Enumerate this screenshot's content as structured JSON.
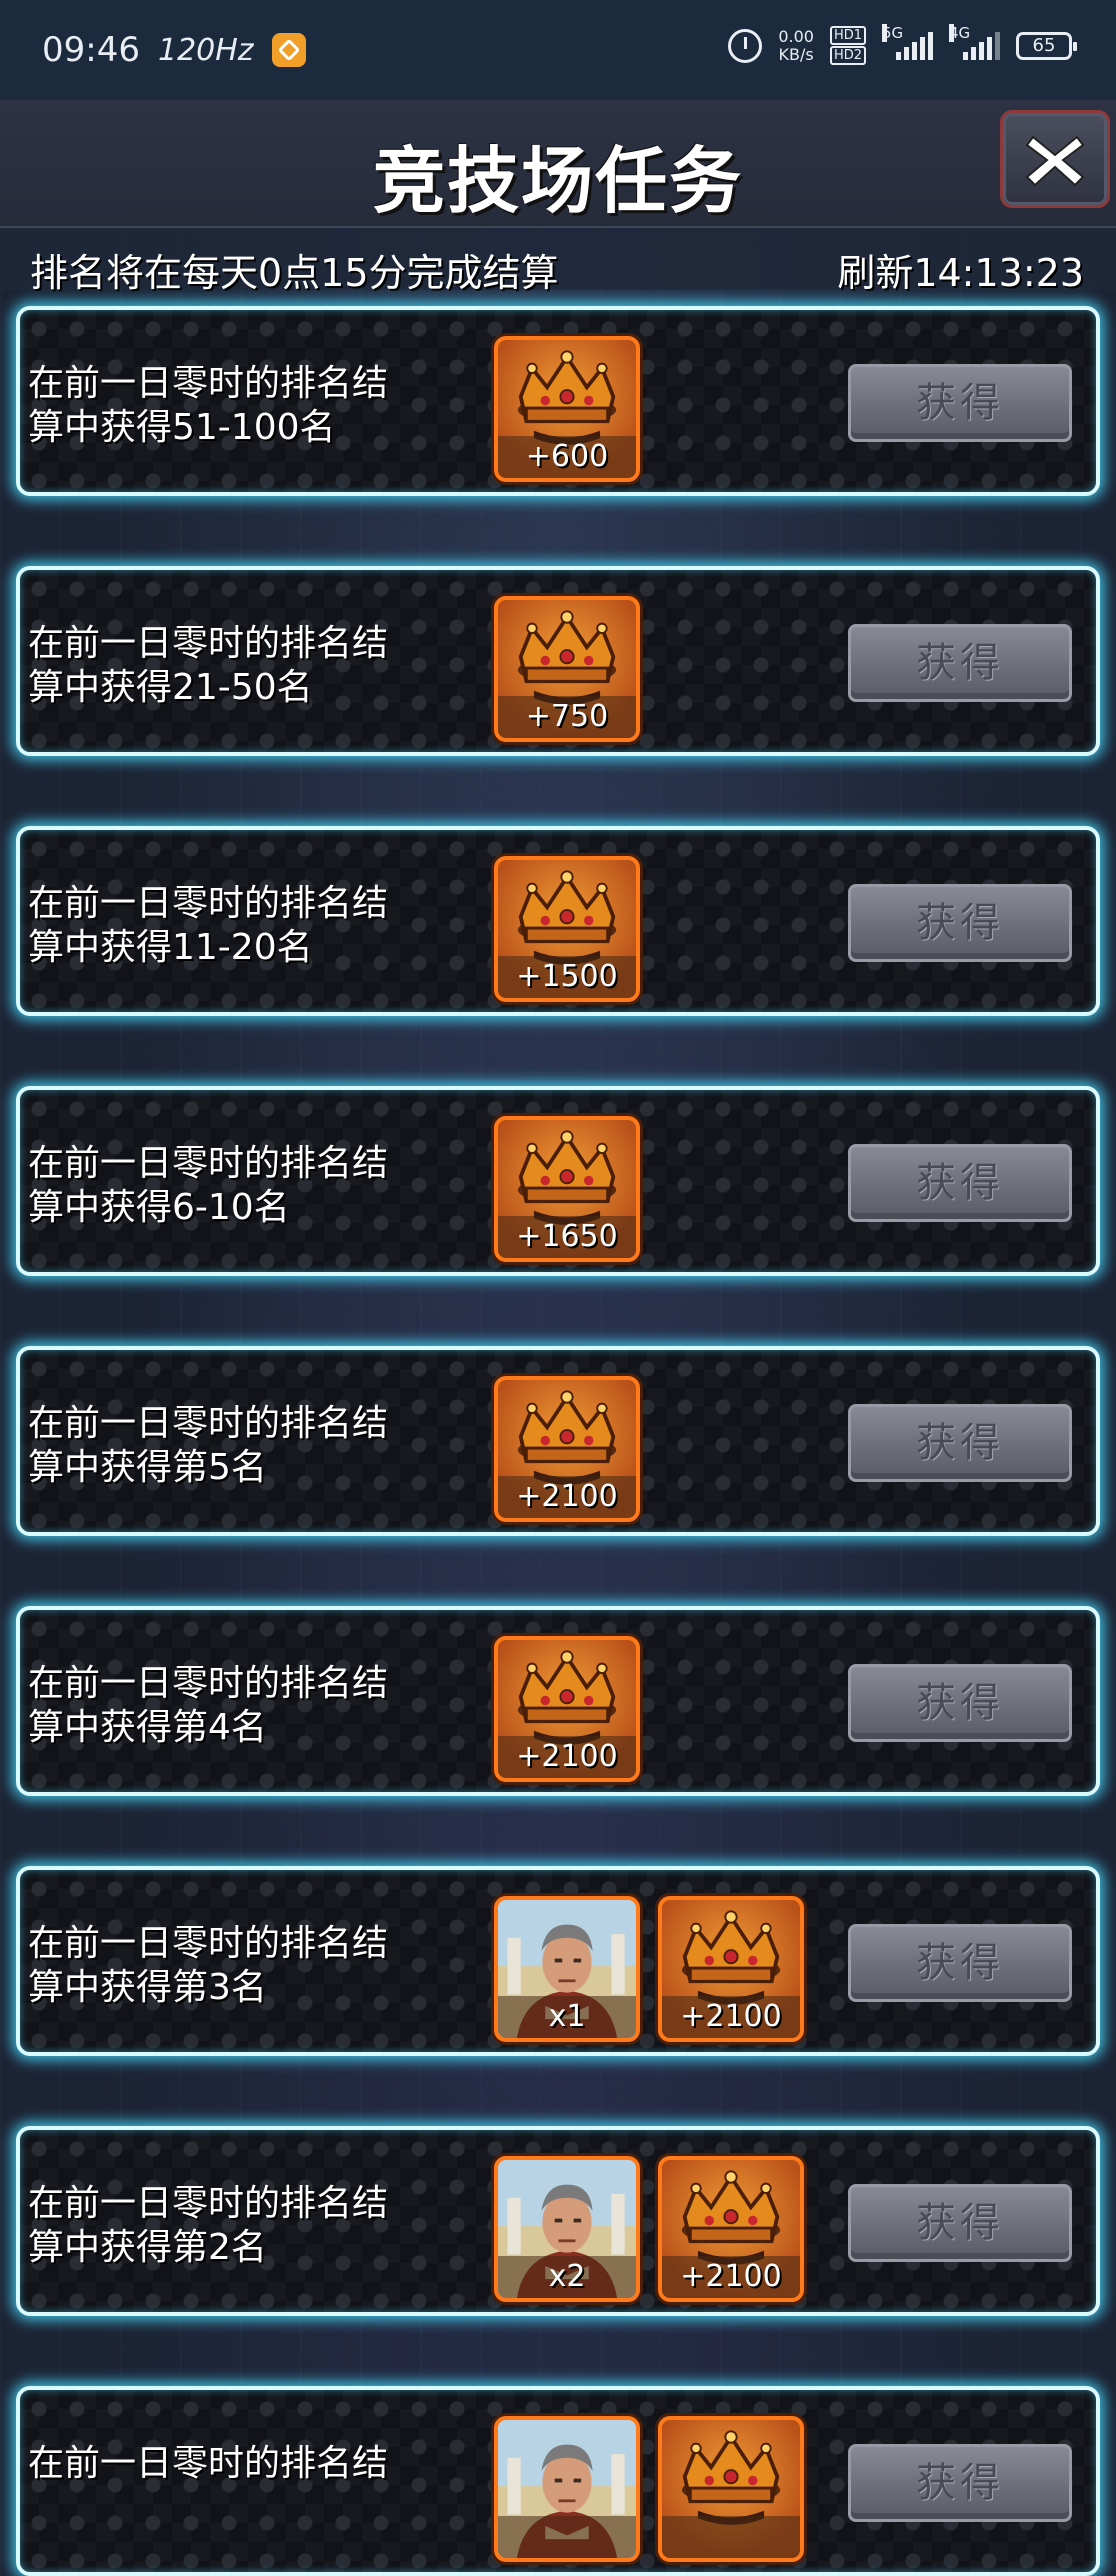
{
  "status_bar": {
    "time": "09:46",
    "refresh_rate": "120Hz",
    "net_speed_value": "0.00",
    "net_speed_unit": "KB/s",
    "hd1": "HD1",
    "hd2": "HD2",
    "sim1": "5G",
    "sim2": "4G",
    "battery": "65"
  },
  "header": {
    "title": "竞技场任务",
    "settle_notice": "排名将在每天0点15分完成结算",
    "refresh_label": "刷新14:13:23"
  },
  "tasks": [
    {
      "desc_line1": "在前一日零时的排名结",
      "desc_line2": "算中获得51-100名",
      "rewards": [
        {
          "icon": "crown-icon",
          "amount": "+600"
        }
      ],
      "button": "获得"
    },
    {
      "desc_line1": "在前一日零时的排名结",
      "desc_line2": "算中获得21-50名",
      "rewards": [
        {
          "icon": "crown-icon",
          "amount": "+750"
        }
      ],
      "button": "获得"
    },
    {
      "desc_line1": "在前一日零时的排名结",
      "desc_line2": "算中获得11-20名",
      "rewards": [
        {
          "icon": "crown-icon",
          "amount": "+1500"
        }
      ],
      "button": "获得"
    },
    {
      "desc_line1": "在前一日零时的排名结",
      "desc_line2": "算中获得6-10名",
      "rewards": [
        {
          "icon": "crown-icon",
          "amount": "+1650"
        }
      ],
      "button": "获得"
    },
    {
      "desc_line1": "在前一日零时的排名结",
      "desc_line2": "算中获得第5名",
      "rewards": [
        {
          "icon": "crown-icon",
          "amount": "+2100"
        }
      ],
      "button": "获得"
    },
    {
      "desc_line1": "在前一日零时的排名结",
      "desc_line2": "算中获得第4名",
      "rewards": [
        {
          "icon": "crown-icon",
          "amount": "+2100"
        }
      ],
      "button": "获得"
    },
    {
      "desc_line1": "在前一日零时的排名结",
      "desc_line2": "算中获得第3名",
      "rewards": [
        {
          "icon": "hero-portrait-icon",
          "amount": "x1"
        },
        {
          "icon": "crown-icon",
          "amount": "+2100"
        }
      ],
      "button": "获得"
    },
    {
      "desc_line1": "在前一日零时的排名结",
      "desc_line2": "算中获得第2名",
      "rewards": [
        {
          "icon": "hero-portrait-icon",
          "amount": "x2"
        },
        {
          "icon": "crown-icon",
          "amount": "+2100"
        }
      ],
      "button": "获得"
    },
    {
      "desc_line1": "在前一日零时的排名结",
      "desc_line2": "",
      "rewards": [
        {
          "icon": "hero-portrait-icon",
          "amount": ""
        },
        {
          "icon": "crown-icon",
          "amount": ""
        }
      ],
      "button": "获得"
    }
  ],
  "colors": {
    "row_glow": "#46dcff",
    "reward_border": "#ff7a1a",
    "button_disabled": "#6c6c78"
  }
}
